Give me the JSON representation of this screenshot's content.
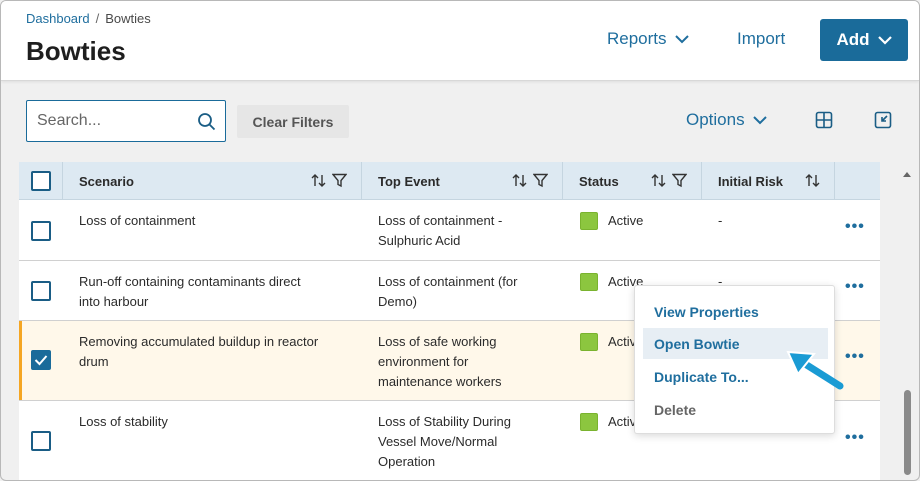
{
  "breadcrumb": {
    "home": "Dashboard",
    "separator": "/",
    "current": "Bowties"
  },
  "page": {
    "title": "Bowties"
  },
  "header_actions": {
    "reports": "Reports",
    "import": "Import",
    "add": "Add"
  },
  "toolbar": {
    "search_placeholder": "Search...",
    "clear_filters": "Clear Filters",
    "options": "Options"
  },
  "table": {
    "columns": [
      "Scenario",
      "Top Event",
      "Status",
      "Initial Risk"
    ],
    "rows": [
      {
        "scenario": [
          "Loss of containment"
        ],
        "top_event": [
          "Loss of containment -",
          "Sulphuric Acid"
        ],
        "status": "Active",
        "initial_risk": "-",
        "checked": false
      },
      {
        "scenario": [
          "Run-off containing contaminants direct",
          "into harbour"
        ],
        "top_event": [
          "Loss of containment (for",
          "Demo)"
        ],
        "status": "Active",
        "initial_risk": "-",
        "checked": false
      },
      {
        "scenario": [
          "Removing accumulated buildup in reactor",
          "drum"
        ],
        "top_event": [
          "Loss of safe working",
          "environment for",
          "maintenance workers"
        ],
        "status": "Activ",
        "initial_risk": "",
        "checked": true
      },
      {
        "scenario": [
          "Loss of stability"
        ],
        "top_event": [
          "Loss of Stability During",
          "Vessel Move/Normal",
          "Operation"
        ],
        "status": "Activ",
        "initial_risk": "",
        "checked": false
      }
    ],
    "more_label": "•••"
  },
  "context_menu": {
    "items": [
      "View Properties",
      "Open Bowtie",
      "Duplicate To...",
      "Delete"
    ],
    "highlighted": "Open Bowtie"
  },
  "colors": {
    "accent": "#1a6b9a",
    "status_active": "#8cc63f",
    "selected_row": "#fff8ea",
    "selected_marker": "#f5a623",
    "header_bg": "#dde9f2"
  }
}
